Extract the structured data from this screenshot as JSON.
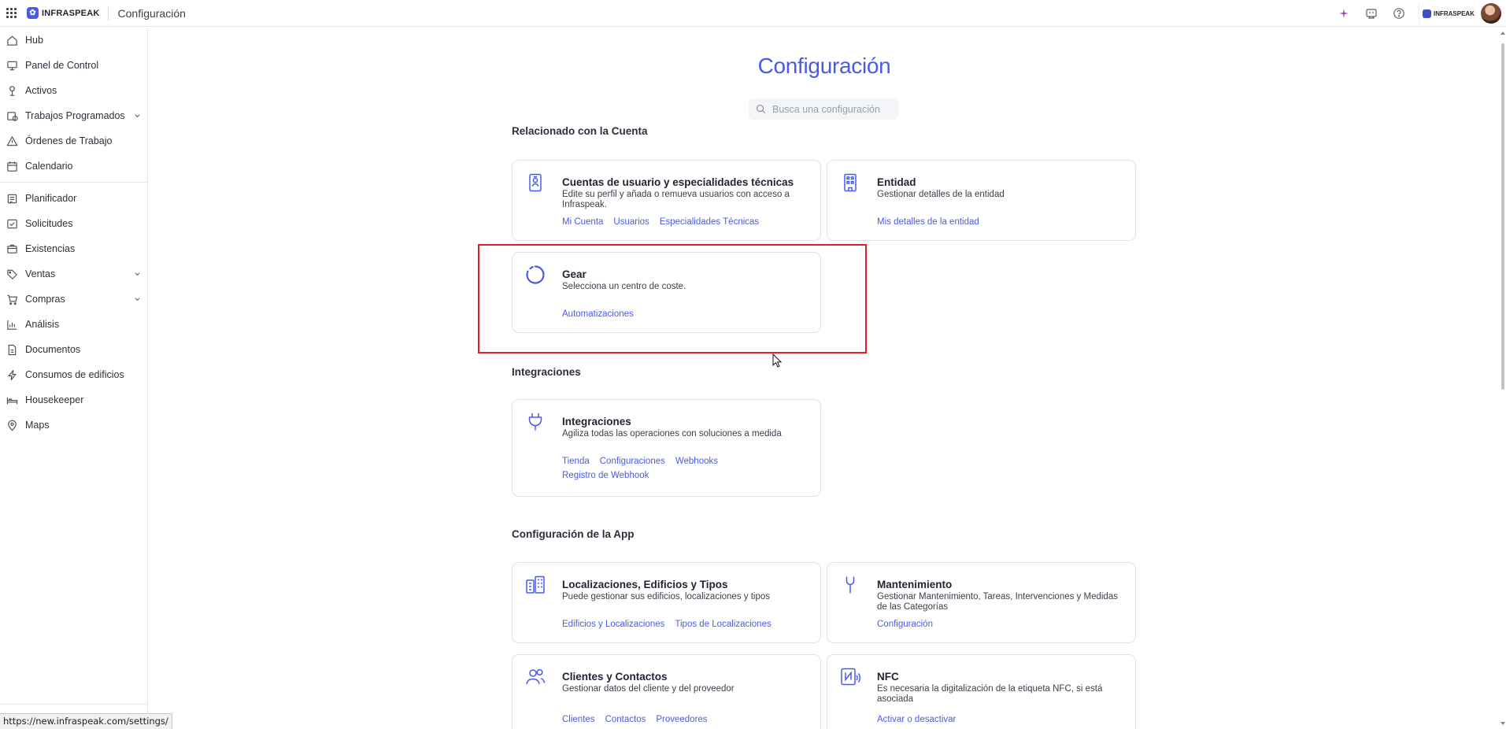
{
  "topbar": {
    "brand": "INFRASPEAK",
    "page_title": "Configuración",
    "company_label": "INFRASPEAK",
    "icons": [
      "apps-grid-icon",
      "sparkle-icon",
      "assistant-icon",
      "help-icon"
    ]
  },
  "sidebar": {
    "items": [
      {
        "label": "Hub",
        "icon": "home-icon"
      },
      {
        "label": "Panel de Control",
        "icon": "dashboard-icon"
      },
      {
        "label": "Activos",
        "icon": "assets-icon"
      },
      {
        "label": "Trabajos Programados",
        "icon": "scheduled-work-icon",
        "expandable": true
      },
      {
        "label": "Órdenes de Trabajo",
        "icon": "warning-icon"
      },
      {
        "label": "Calendario",
        "icon": "calendar-icon"
      },
      {
        "label": "Planificador",
        "icon": "planner-icon"
      },
      {
        "label": "Solicitudes",
        "icon": "requests-icon"
      },
      {
        "label": "Existencias",
        "icon": "stock-icon"
      },
      {
        "label": "Ventas",
        "icon": "tag-icon",
        "expandable": true
      },
      {
        "label": "Compras",
        "icon": "cart-icon",
        "expandable": true
      },
      {
        "label": "Análisis",
        "icon": "chart-icon"
      },
      {
        "label": "Documentos",
        "icon": "document-icon"
      },
      {
        "label": "Consumos de edificios",
        "icon": "lightning-icon"
      },
      {
        "label": "Housekeeper",
        "icon": "bed-icon"
      },
      {
        "label": "Maps",
        "icon": "map-pin-icon"
      }
    ]
  },
  "status_url": "https://new.infraspeak.com/settings/",
  "main": {
    "title": "Configuración",
    "search_placeholder": "Busca una configuración",
    "sections": {
      "account": "Relacionado con la Cuenta",
      "integrations": "Integraciones",
      "app": "Configuración de la App"
    },
    "cards": {
      "users": {
        "title": "Cuentas de usuario y especialidades técnicas",
        "desc": "Edite su perfil y añada o remueva usuarios con acceso a Infraspeak.",
        "links": [
          "Mi Cuenta",
          "Usuarios",
          "Especialidades Técnicas"
        ]
      },
      "entity": {
        "title": "Entidad",
        "desc": "Gestionar detalles de la entidad",
        "links": [
          "Mis detalles de la entidad"
        ]
      },
      "gear": {
        "title": "Gear",
        "desc": "Selecciona un centro de coste.",
        "links": [
          "Automatizaciones"
        ]
      },
      "integrations": {
        "title": "Integraciones",
        "desc": "Agiliza todas las operaciones con soluciones a medida",
        "links": [
          "Tienda",
          "Configuraciones",
          "Webhooks",
          "Registro de Webhook"
        ]
      },
      "locations": {
        "title": "Localizaciones, Edificios y Tipos",
        "desc": "Puede gestionar sus edificios, localizaciones y tipos",
        "links": [
          "Edificios y Localizaciones",
          "Tipos de Localizaciones"
        ]
      },
      "maintenance": {
        "title": "Mantenimiento",
        "desc": "Gestionar Mantenimiento, Tareas, Intervenciones y Medidas de las Categorías",
        "links": [
          "Configuración"
        ]
      },
      "clients": {
        "title": "Clientes y Contactos",
        "desc": "Gestionar datos del cliente y del proveedor",
        "links": [
          "Clientes",
          "Contactos",
          "Proveedores"
        ]
      },
      "nfc": {
        "title": "NFC",
        "desc": "Es necesaria la digitalización de la etiqueta NFC, si está asociada",
        "links": [
          "Activar o desactivar"
        ]
      }
    }
  },
  "colors": {
    "accent": "#4a5ae8",
    "highlight": "#e01f26",
    "border": "#dfe2e8"
  }
}
